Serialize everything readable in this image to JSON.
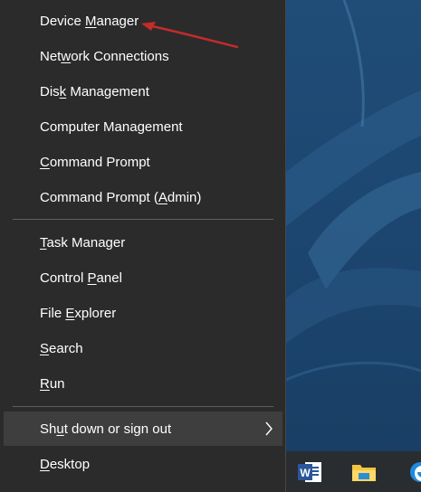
{
  "menu": {
    "items": [
      {
        "id": "device-manager",
        "pre": "Device ",
        "key": "M",
        "post": "anager"
      },
      {
        "id": "network-connections",
        "pre": "Net",
        "key": "w",
        "post": "ork Connections"
      },
      {
        "id": "disk-management",
        "pre": "Dis",
        "key": "k",
        "post": " Management"
      },
      {
        "id": "computer-management",
        "pre": "Computer Mana",
        "key": "g",
        "post": "ement"
      },
      {
        "id": "command-prompt",
        "pre": "",
        "key": "C",
        "post": "ommand Prompt"
      },
      {
        "id": "command-prompt-admin",
        "pre": "Command Prompt (",
        "key": "A",
        "post": "dmin)"
      },
      {
        "id": "task-manager",
        "pre": "",
        "key": "T",
        "post": "ask Manager"
      },
      {
        "id": "control-panel",
        "pre": "Control ",
        "key": "P",
        "post": "anel"
      },
      {
        "id": "file-explorer",
        "pre": "File ",
        "key": "E",
        "post": "xplorer"
      },
      {
        "id": "search",
        "pre": "",
        "key": "S",
        "post": "earch"
      },
      {
        "id": "run",
        "pre": "",
        "key": "R",
        "post": "un"
      },
      {
        "id": "shut-down",
        "pre": "Sh",
        "key": "u",
        "post": "t down or sign out"
      },
      {
        "id": "desktop",
        "pre": "",
        "key": "D",
        "post": "esktop"
      }
    ],
    "highlighted_item": "shut-down",
    "submenu_icon": "chevron-right-icon"
  },
  "taskbar": {
    "icons": [
      "word-icon",
      "file-explorer-icon",
      "edge-icon"
    ]
  },
  "annotation": {
    "type": "arrow",
    "color": "#c42b2b",
    "target": "device-manager"
  },
  "colors": {
    "menu_background": "#2b2b2b",
    "menu_text": "#ffffff",
    "highlight": "#3e3e3e",
    "separator": "#5f5f5f",
    "wallpaper": "#1f4d78",
    "taskbar": "#2a2d30"
  }
}
